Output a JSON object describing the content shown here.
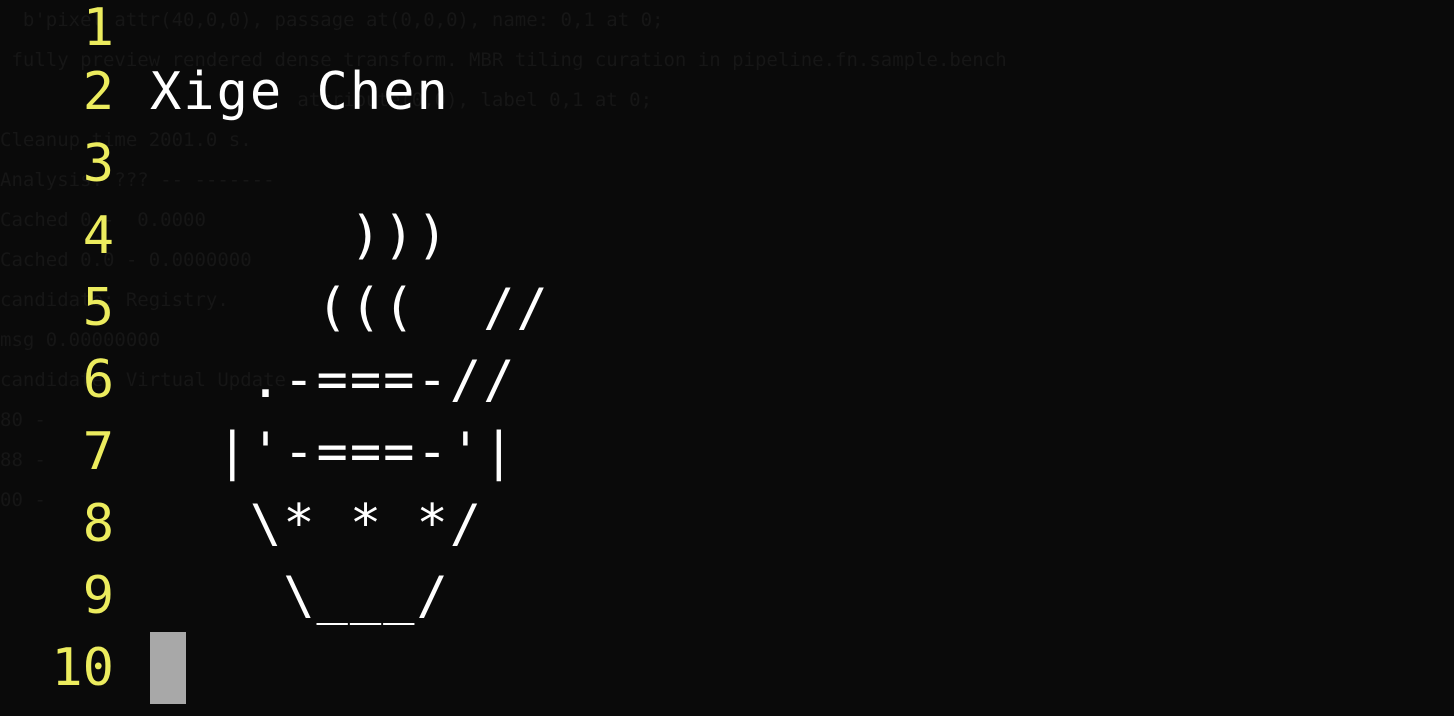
{
  "ghost_text": [
    "  b'pixel attr(40,0,0), passage at(0,0,0), name: 0,1 at 0;",
    "",
    " fully preview rendered dense transform. MBR tiling curation in pipeline.fn.sample.bench",
    "                          attribute(0,0), label 0,1 at 0;",
    "",
    "Cleanup time 2001.0 s.",
    "Analysis: ??? -- -------",
    "Cached 0 -  0.0000",
    "Cached 0.0 - 0.0000000",
    "",
    "",
    "candidate: Registry.",
    "msg 0.00000000",
    "",
    "candidate: Virtual Update",
    "80 -",
    "88 -",
    "00 -"
  ],
  "editor": {
    "lines": [
      {
        "number": "1",
        "text": ""
      },
      {
        "number": "2",
        "text": "Xige Chen"
      },
      {
        "number": "3",
        "text": ""
      },
      {
        "number": "4",
        "text": "      )))"
      },
      {
        "number": "5",
        "text": "     (((  //"
      },
      {
        "number": "6",
        "text": "   .-===-//"
      },
      {
        "number": "7",
        "text": "  |'-===-'|"
      },
      {
        "number": "8",
        "text": "   \\* * */"
      },
      {
        "number": "9",
        "text": "    \\___/"
      },
      {
        "number": "10",
        "text": ""
      }
    ]
  }
}
